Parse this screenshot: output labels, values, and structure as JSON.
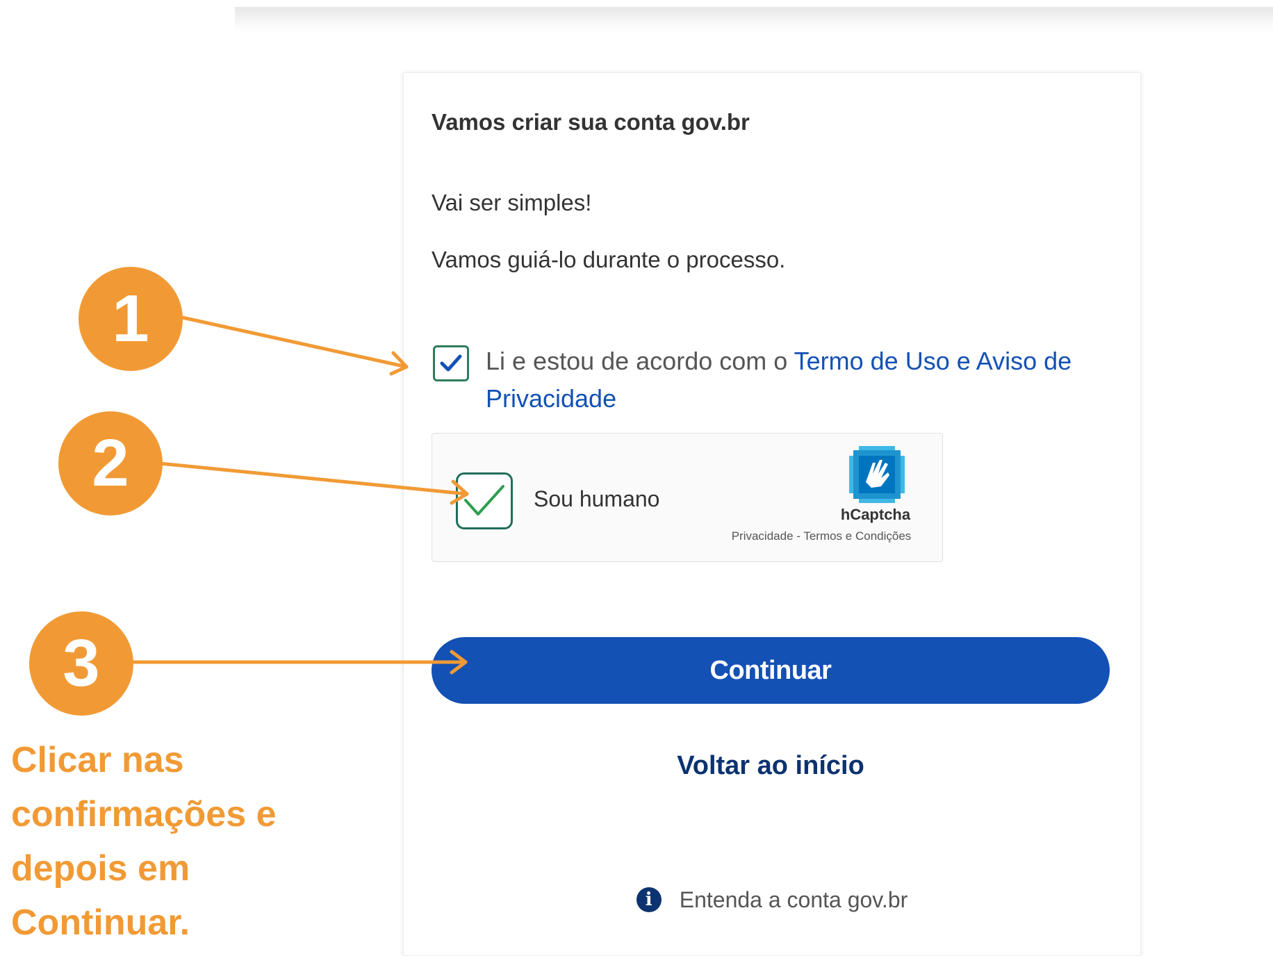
{
  "card": {
    "title": "Vamos criar sua conta gov.br",
    "line1": "Vai ser simples!",
    "line2": "Vamos guiá-lo durante o processo.",
    "terms_prefix": "Li e estou de acordo com o ",
    "terms_link": "Termo de Uso e Aviso de Privacidade",
    "terms_checked": true,
    "captcha": {
      "label": "Sou humano",
      "brand": "hCaptcha",
      "footer": "Privacidade - Termos e Condições",
      "checked": true
    },
    "continue_label": "Continuar",
    "back_label": "Voltar ao início",
    "info_label": "Entenda a conta gov.br"
  },
  "annotations": {
    "steps": [
      "1",
      "2",
      "3"
    ],
    "instruction_lines": [
      "Clicar nas",
      "confirmações e",
      "depois em",
      "Continuar."
    ],
    "accent_color": "#f19a35"
  },
  "colors": {
    "primary_blue": "#1351b4",
    "dark_blue": "#0c326f",
    "check_green": "#2e7d5b"
  }
}
